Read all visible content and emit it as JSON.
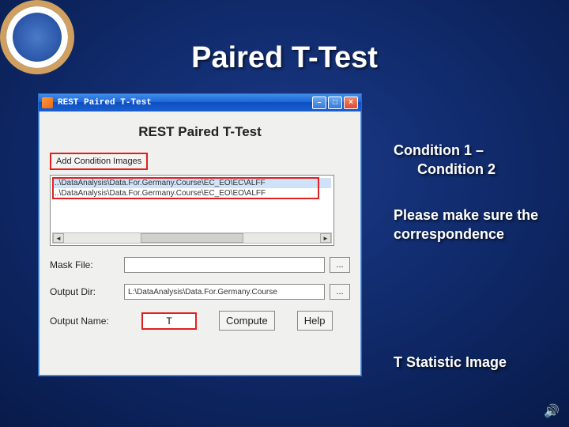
{
  "slide": {
    "title": "Paired T-Test"
  },
  "window": {
    "title": "REST Paired T-Test",
    "panel_header": "REST Paired T-Test",
    "add_button": "Add Condition Images",
    "list": {
      "row1": "..\\DataAnalysis\\Data.For.Germany.Course\\EC_EO\\EC\\ALFF",
      "row2": "..\\DataAnalysis\\Data.For.Germany.Course\\EC_EO\\EO\\ALFF"
    },
    "mask_label": "Mask File:",
    "mask_value": "",
    "output_dir_label": "Output Dir:",
    "output_dir_value": "L:\\DataAnalysis\\Data.For.Germany.Course",
    "output_name_label": "Output Name:",
    "output_name_value": "T",
    "browse_label": "...",
    "compute_label": "Compute",
    "help_label": "Help",
    "min_label": "–",
    "max_label": "□",
    "close_label": "×"
  },
  "annotations": {
    "a1_line1": "Condition 1 –",
    "a1_line2": "Condition 2",
    "a2": "Please make sure the correspondence",
    "a3": "T Statistic Image"
  },
  "icons": {
    "sound": "🔊"
  }
}
